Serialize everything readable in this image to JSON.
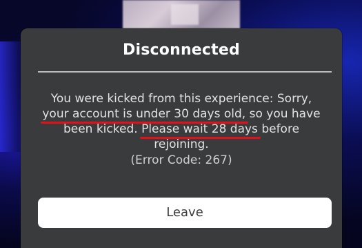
{
  "dialog": {
    "title": "Disconnected",
    "message": {
      "line1": "You were kicked from this experience: Sorry,",
      "line2_underlined": "your account is under 30 days old,",
      "line2_rest": " so you have",
      "line3_start": "been kicked. ",
      "line3_underlined": "Please wait 28 days",
      "line3_rest": " before",
      "line4": "rejoining.",
      "error_code": "(Error Code: 267)"
    },
    "leave_label": "Leave"
  },
  "colors": {
    "dialog_bg": "#393b3d",
    "button_bg": "#ffffff",
    "annotation_underline": "#e5101a"
  }
}
